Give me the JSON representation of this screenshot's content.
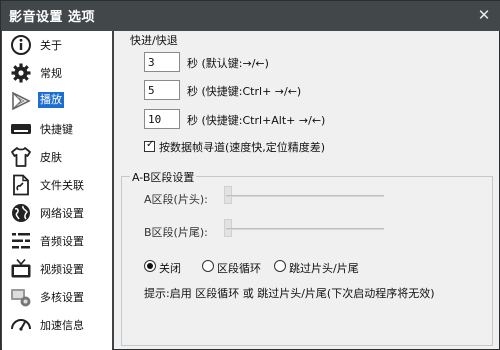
{
  "window": {
    "title": "影音设置 选项",
    "close_glyph": "✕"
  },
  "sidebar": {
    "items": [
      {
        "label": "关于",
        "icon": "info-icon"
      },
      {
        "label": "常规",
        "icon": "gear-icon"
      },
      {
        "label": "播放",
        "icon": "play-icon",
        "active": true
      },
      {
        "label": "快捷键",
        "icon": "keyboard-icon"
      },
      {
        "label": "皮肤",
        "icon": "shirt-icon"
      },
      {
        "label": "文件关联",
        "icon": "file-association-icon"
      },
      {
        "label": "网络设置",
        "icon": "globe-icon"
      },
      {
        "label": "音频设置",
        "icon": "audio-icon"
      },
      {
        "label": "视频设置",
        "icon": "tv-icon"
      },
      {
        "label": "多核设置",
        "icon": "multicore-icon"
      },
      {
        "label": "加速信息",
        "icon": "speedometer-icon"
      }
    ]
  },
  "seek": {
    "group_title": "快进/快退",
    "rows": [
      {
        "value": "3",
        "label": "秒 (默认键:→/←)"
      },
      {
        "value": "5",
        "label": "秒 (快捷键:Ctrl+ →/←)"
      },
      {
        "value": "10",
        "label": "秒 (快捷键:Ctrl+Alt+ →/←)"
      }
    ],
    "keyframe_checkbox_label": "按数据帧寻道(速度快,定位精度差)",
    "keyframe_checked": true
  },
  "ab_section": {
    "group_title": "A-B区段设置",
    "a_label": "A区段(片头):",
    "b_label": "B区段(片尾):",
    "radios": [
      {
        "label": "关闭",
        "checked": true
      },
      {
        "label": "区段循环",
        "checked": false
      },
      {
        "label": "跳过片头/片尾",
        "checked": false
      }
    ],
    "hint": "提示:启用 区段循环 或 跳过片头/片尾(下次启动程序将无效)"
  }
}
